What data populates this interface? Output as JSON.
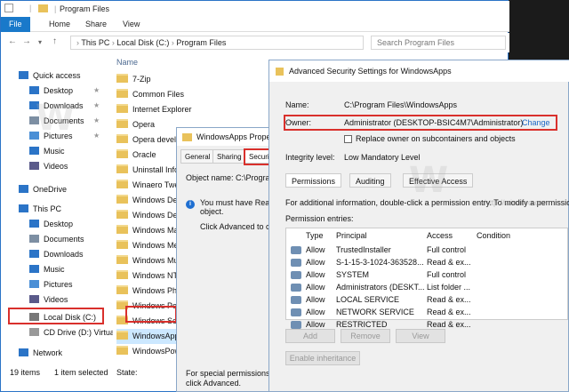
{
  "explorer": {
    "title": "Program Files",
    "ribbon_tabs": [
      "File",
      "Home",
      "Share",
      "View"
    ],
    "address": [
      "This PC",
      "Local Disk (C:)",
      "Program Files"
    ],
    "search_placeholder": "Search Program Files",
    "nav": [
      {
        "label": "Quick access",
        "icon": "star-icon",
        "pinned": false
      },
      {
        "label": "Desktop",
        "icon": "desktop-icon",
        "pinned": true
      },
      {
        "label": "Downloads",
        "icon": "downloads-icon",
        "pinned": true
      },
      {
        "label": "Documents",
        "icon": "documents-icon",
        "pinned": true
      },
      {
        "label": "Pictures",
        "icon": "pictures-icon",
        "pinned": true
      },
      {
        "label": "Music",
        "icon": "music-icon",
        "pinned": false
      },
      {
        "label": "Videos",
        "icon": "videos-icon",
        "pinned": false
      },
      {
        "label": "OneDrive",
        "icon": "cloud-icon",
        "pinned": false
      },
      {
        "label": "This PC",
        "icon": "computer-icon",
        "pinned": false
      },
      {
        "label": "Desktop",
        "icon": "desktop-icon",
        "pinned": false
      },
      {
        "label": "Documents",
        "icon": "documents-icon",
        "pinned": false
      },
      {
        "label": "Downloads",
        "icon": "downloads-icon",
        "pinned": false
      },
      {
        "label": "Music",
        "icon": "music-icon",
        "pinned": false
      },
      {
        "label": "Pictures",
        "icon": "pictures-icon",
        "pinned": false
      },
      {
        "label": "Videos",
        "icon": "videos-icon",
        "pinned": false
      },
      {
        "label": "Local Disk (C:)",
        "icon": "drive-icon",
        "pinned": false
      },
      {
        "label": "CD Drive (D:) Virtua",
        "icon": "cd-drive-icon",
        "pinned": false
      },
      {
        "label": "Network",
        "icon": "network-icon",
        "pinned": false
      }
    ],
    "column_name": "Name",
    "files": [
      "7-Zip",
      "Common Files",
      "Internet Explorer",
      "Opera",
      "Opera develo",
      "Oracle",
      "Uninstall Info",
      "Winaero Twe",
      "Windows Def",
      "Windows Def",
      "Windows Ma",
      "Windows Me",
      "Windows Mu",
      "Windows NT",
      "Windows Pho",
      "Windows Por",
      "Windows Sec",
      "WindowsApp",
      "WindowsPow"
    ],
    "status_items": "19 items",
    "status_selected": "1 item selected",
    "status_state": "State:"
  },
  "props": {
    "title": "WindowsApps Properti",
    "tabs": [
      "General",
      "Sharing",
      "Security"
    ],
    "object_name_label": "Object name:",
    "object_name_value": "C:\\Progra",
    "notice": "You must have Read pe",
    "notice2": "object.",
    "click_advanced": "Click Advanced to cont",
    "footer1": "For special permissions or a",
    "footer2": "click Advanced."
  },
  "adv": {
    "title": "Advanced Security Settings for WindowsApps",
    "name_label": "Name:",
    "name_value": "C:\\Program Files\\WindowsApps",
    "owner_label": "Owner:",
    "owner_value": "Administrator (DESKTOP-BSIC4M7\\Administrator)",
    "change_label": "Change",
    "replace_owner_label": "Replace owner on subcontainers and objects",
    "integrity_label": "Integrity level:",
    "integrity_value": "Low Mandatory Level",
    "tabs": [
      "Permissions",
      "Auditing",
      "Effective Access"
    ],
    "info_text": "For additional information, double-click a permission entry. To modify a permissio",
    "entries_label": "Permission entries:",
    "columns": [
      "Type",
      "Principal",
      "Access",
      "Condition"
    ],
    "rows": [
      {
        "type": "Allow",
        "principal": "TrustedInstaller",
        "access": "Full control"
      },
      {
        "type": "Allow",
        "principal": "S-1-15-3-1024-363528...",
        "access": "Read & ex..."
      },
      {
        "type": "Allow",
        "principal": "SYSTEM",
        "access": "Full control"
      },
      {
        "type": "Allow",
        "principal": "Administrators (DESKT...",
        "access": "List folder ..."
      },
      {
        "type": "Allow",
        "principal": "LOCAL SERVICE",
        "access": "Read & ex..."
      },
      {
        "type": "Allow",
        "principal": "NETWORK SERVICE",
        "access": "Read & ex..."
      },
      {
        "type": "Allow",
        "principal": "RESTRICTED",
        "access": "Read & ex..."
      }
    ],
    "buttons": [
      "Add",
      "Remove",
      "View"
    ],
    "enable_inheritance": "Enable inheritance"
  },
  "watermark": "http://winaero.com",
  "colors": {
    "accent": "#1979ca",
    "highlight": "#d9302c",
    "link": "#1a66c5"
  }
}
